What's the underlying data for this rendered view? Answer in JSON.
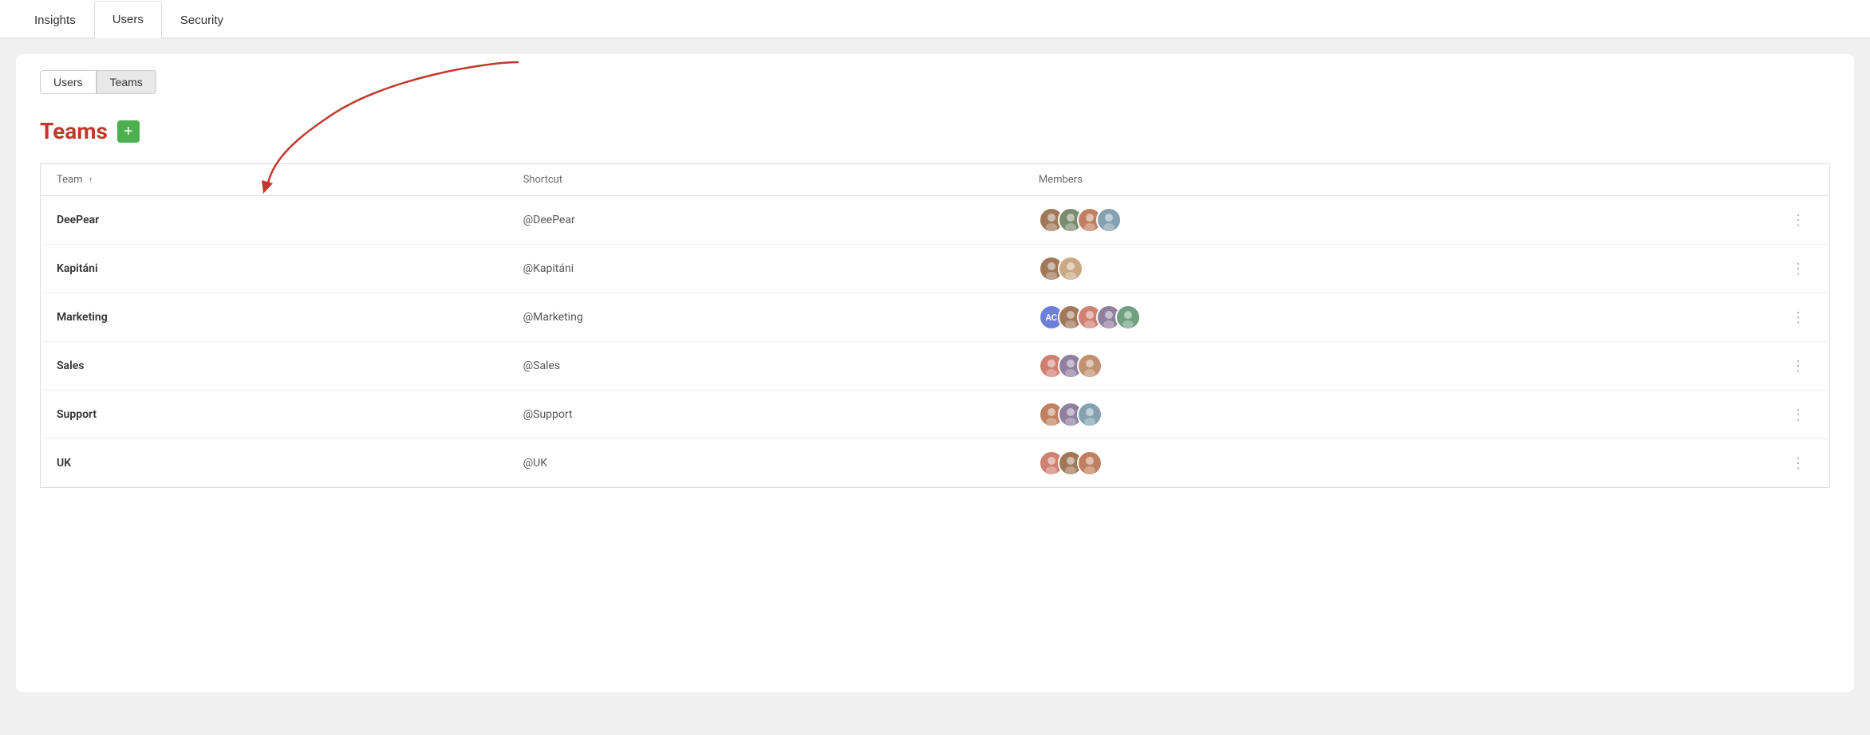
{
  "topNav": {
    "tabs": [
      {
        "id": "insights",
        "label": "Insights",
        "active": false
      },
      {
        "id": "users",
        "label": "Users",
        "active": true
      },
      {
        "id": "security",
        "label": "Security",
        "active": false
      }
    ]
  },
  "subTabs": {
    "tabs": [
      {
        "id": "users",
        "label": "Users",
        "active": false
      },
      {
        "id": "teams",
        "label": "Teams",
        "active": true
      }
    ]
  },
  "teamsSection": {
    "title": "Teams",
    "addButton": "+",
    "table": {
      "columns": [
        {
          "id": "team",
          "label": "Team",
          "sortable": true,
          "sortDir": "asc"
        },
        {
          "id": "shortcut",
          "label": "Shortcut",
          "sortable": false
        },
        {
          "id": "members",
          "label": "Members",
          "sortable": false
        }
      ],
      "rows": [
        {
          "name": "DeePear",
          "shortcut": "@DeePear",
          "memberCount": 4,
          "memberColors": [
            "#a07858",
            "#7a8b6e",
            "#c08060",
            "#85a0b0"
          ]
        },
        {
          "name": "Kapitáni",
          "shortcut": "@Kapitáni",
          "memberCount": 2,
          "memberColors": [
            "#a07858",
            "#c9a882"
          ]
        },
        {
          "name": "Marketing",
          "shortcut": "@Marketing",
          "memberCount": 5,
          "memberColors": [
            "#6c7fdb",
            "#a0785a",
            "#d08070",
            "#9080a0",
            "#70a080"
          ],
          "hasInitials": true,
          "initials": "AC"
        },
        {
          "name": "Sales",
          "shortcut": "@Sales",
          "memberCount": 3,
          "memberColors": [
            "#d08070",
            "#9080a0",
            "#c09070"
          ]
        },
        {
          "name": "Support",
          "shortcut": "@Support",
          "memberCount": 3,
          "memberColors": [
            "#c08060",
            "#9080a0",
            "#85a0b0"
          ]
        },
        {
          "name": "UK",
          "shortcut": "@UK",
          "memberCount": 3,
          "memberColors": [
            "#d08070",
            "#a07858",
            "#c08060"
          ]
        }
      ]
    }
  }
}
